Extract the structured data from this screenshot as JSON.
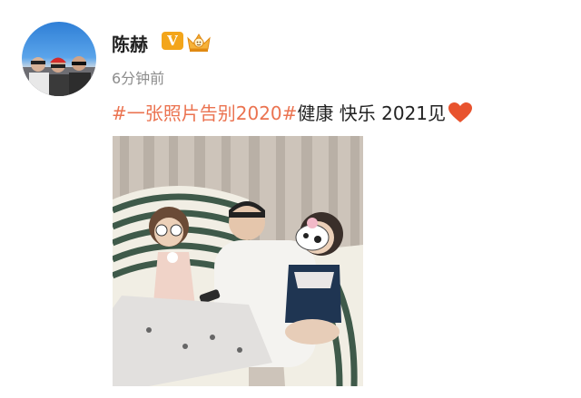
{
  "user": {
    "name": "陈赫",
    "verified_badge": "V",
    "crown_icon": "crown-icon"
  },
  "post": {
    "time": "6分钟前",
    "hashtag": "#一张照片告别2020#",
    "text": "健康 快乐 2021见",
    "heart_icon": "heart-icon"
  },
  "colors": {
    "hashtag": "#eb7350",
    "heart": "#e8532e",
    "vbadge": "#f3a51a"
  }
}
